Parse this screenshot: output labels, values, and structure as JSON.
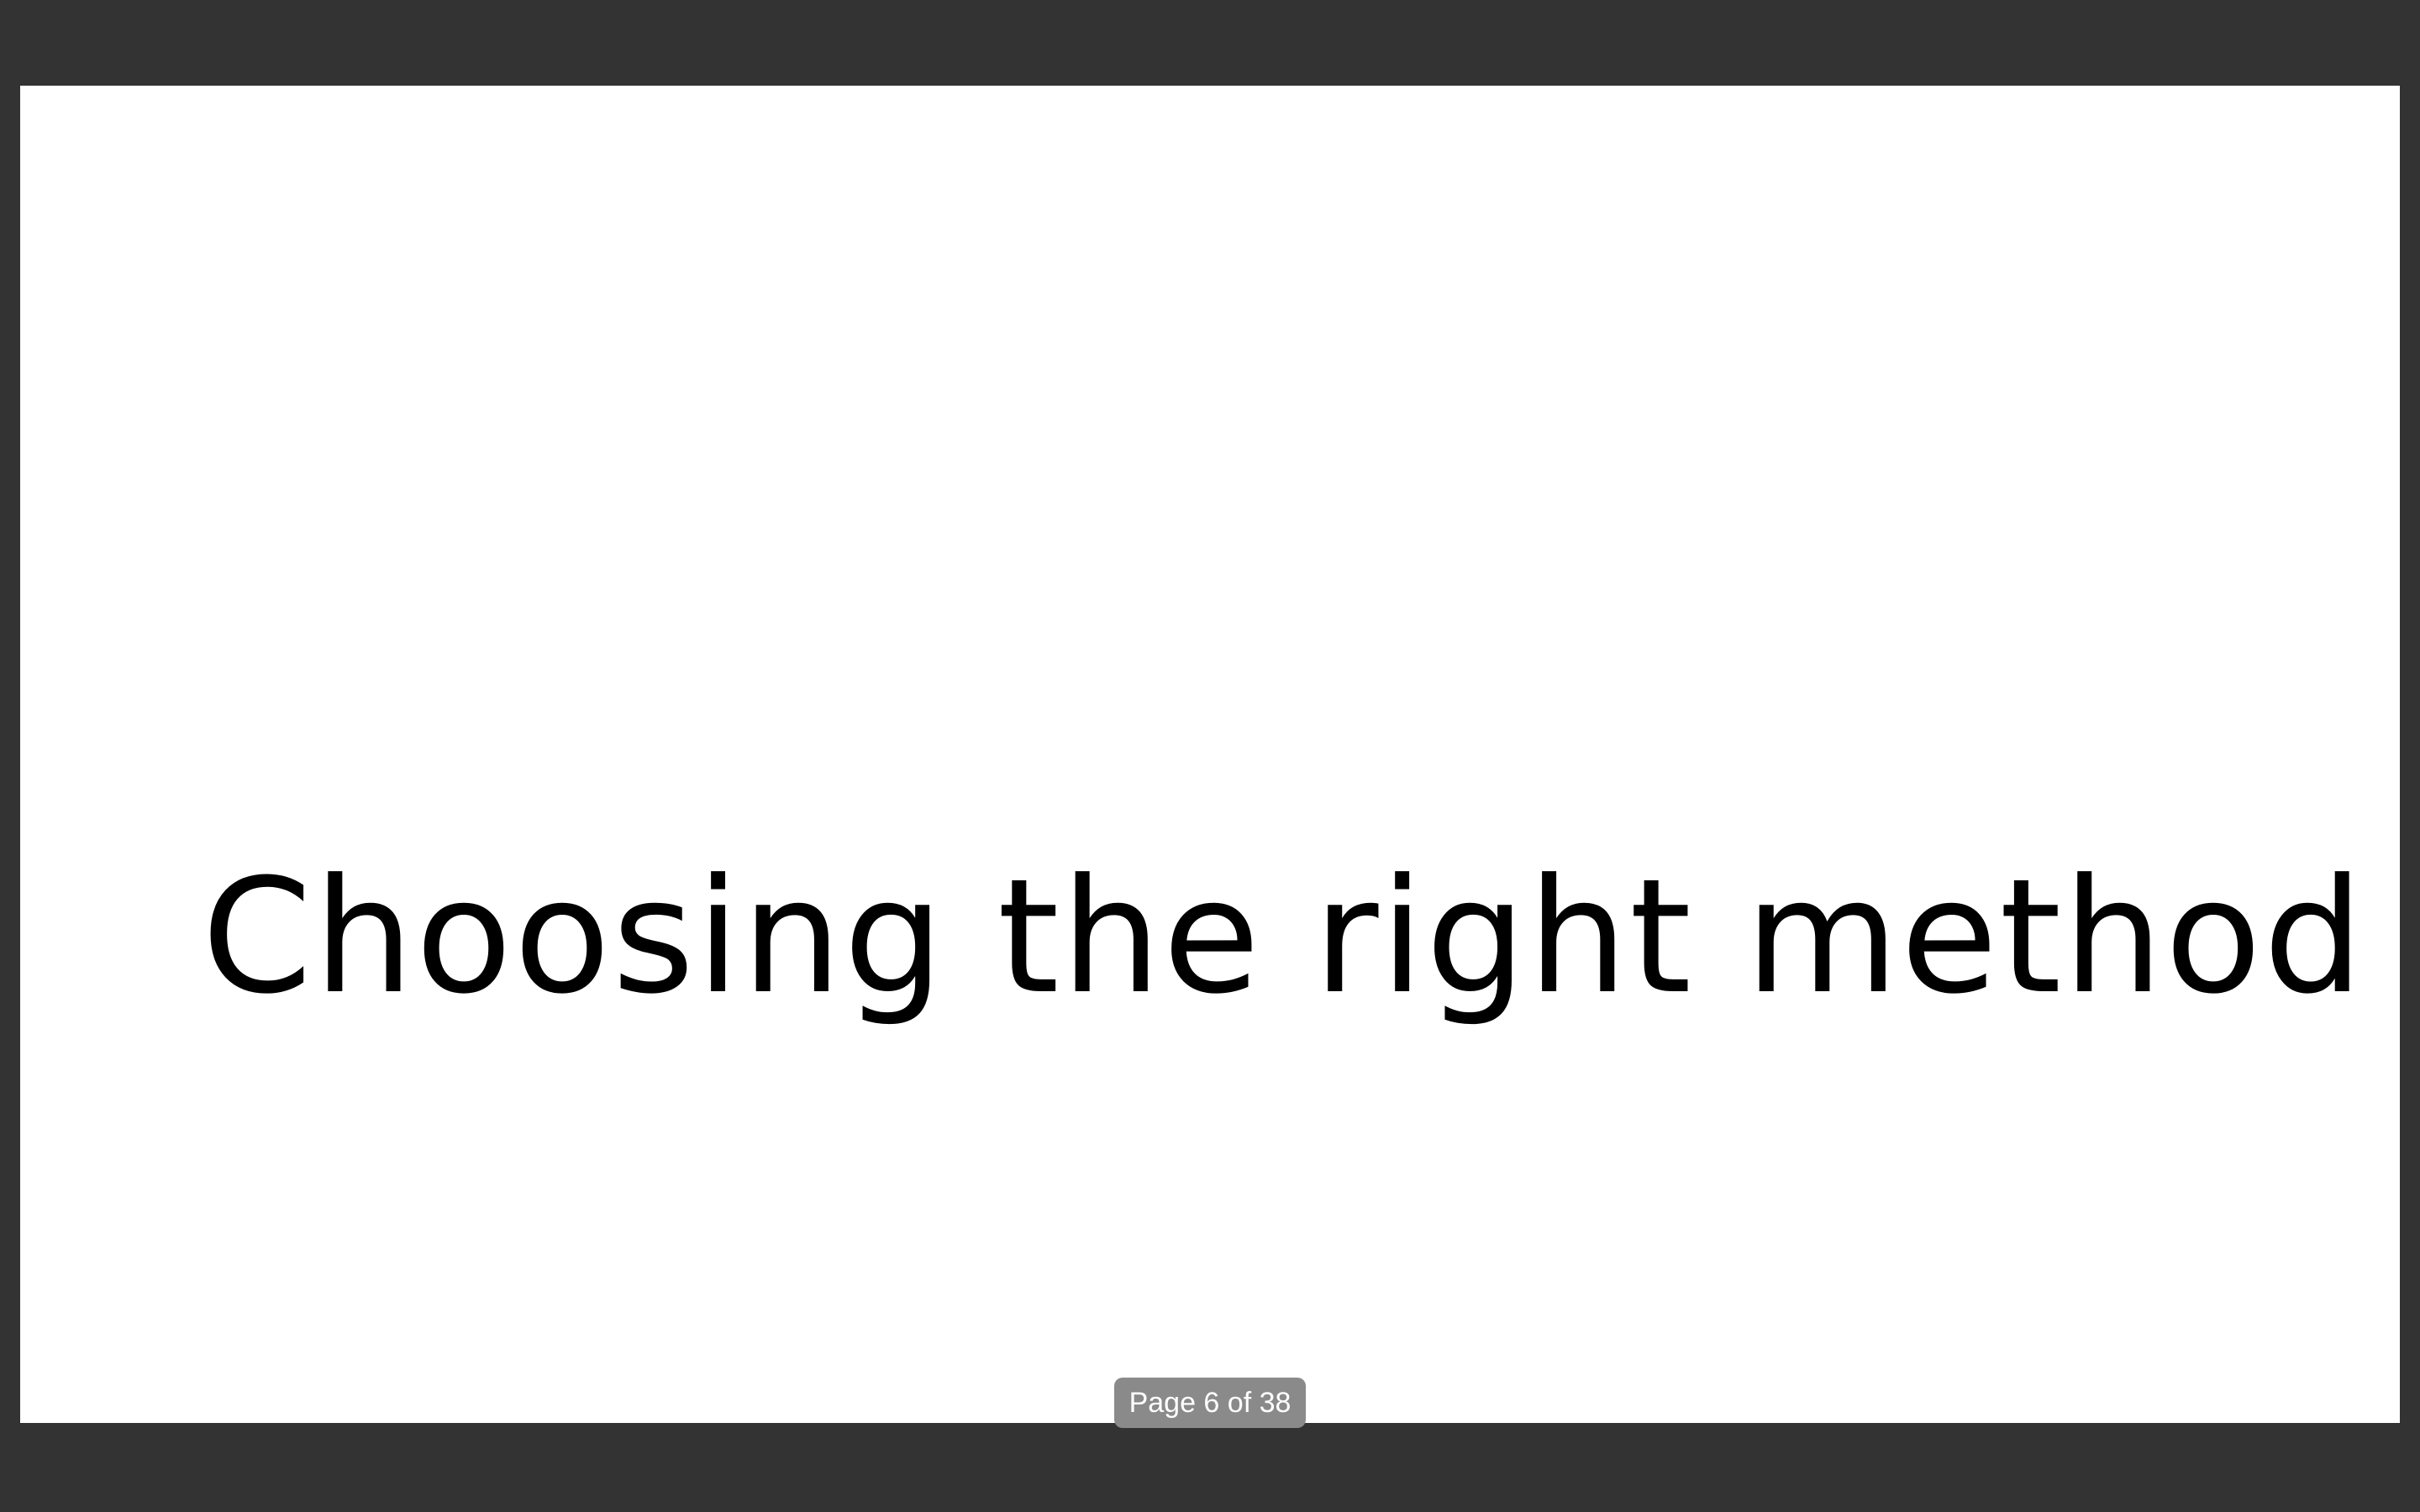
{
  "slide": {
    "title": "Choosing the right method"
  },
  "page_indicator": {
    "text": "Page 6 of 38"
  },
  "colors": {
    "viewer_background": "#333333",
    "slide_background": "#ffffff",
    "title_text": "#000000",
    "page_indicator_background": "#8a8a8a",
    "page_indicator_text": "#ffffff"
  }
}
